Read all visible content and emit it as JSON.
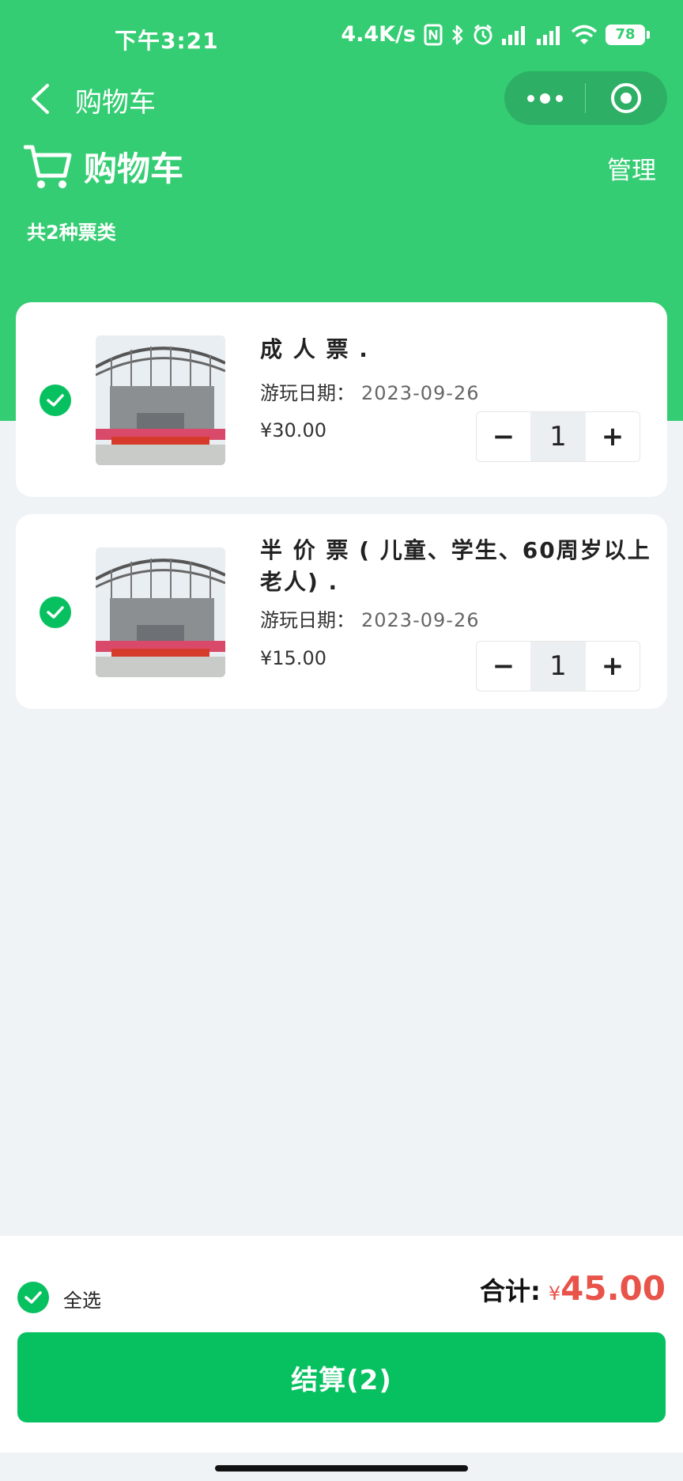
{
  "status_bar": {
    "time": "下午3:21",
    "network_speed": "4.4K/s",
    "battery": "78"
  },
  "nav": {
    "title": "购物车"
  },
  "header": {
    "title": "购物车",
    "manage": "管理",
    "count_text": "共2种票类"
  },
  "items": [
    {
      "name": "成 人 票 .",
      "date_label": "游玩日期：",
      "date": "2023-09-26",
      "price": "¥30.00",
      "quantity": "1",
      "checked": true
    },
    {
      "name": "半 价 票 ( 儿童、学生、60周岁以上老人) .",
      "date_label": "游玩日期：",
      "date": "2023-09-26",
      "price": "¥15.00",
      "quantity": "1",
      "checked": true
    }
  ],
  "stepper": {
    "minus": "−",
    "plus": "+"
  },
  "footer": {
    "select_all": "全选",
    "total_label": "合计:",
    "currency": "¥",
    "total_amount": "45.00",
    "checkout": "结算(2)"
  },
  "colors": {
    "header_green": "#35cd73",
    "check_green": "#07c160",
    "price_red": "#e8534a",
    "background": "#eff3f6"
  }
}
